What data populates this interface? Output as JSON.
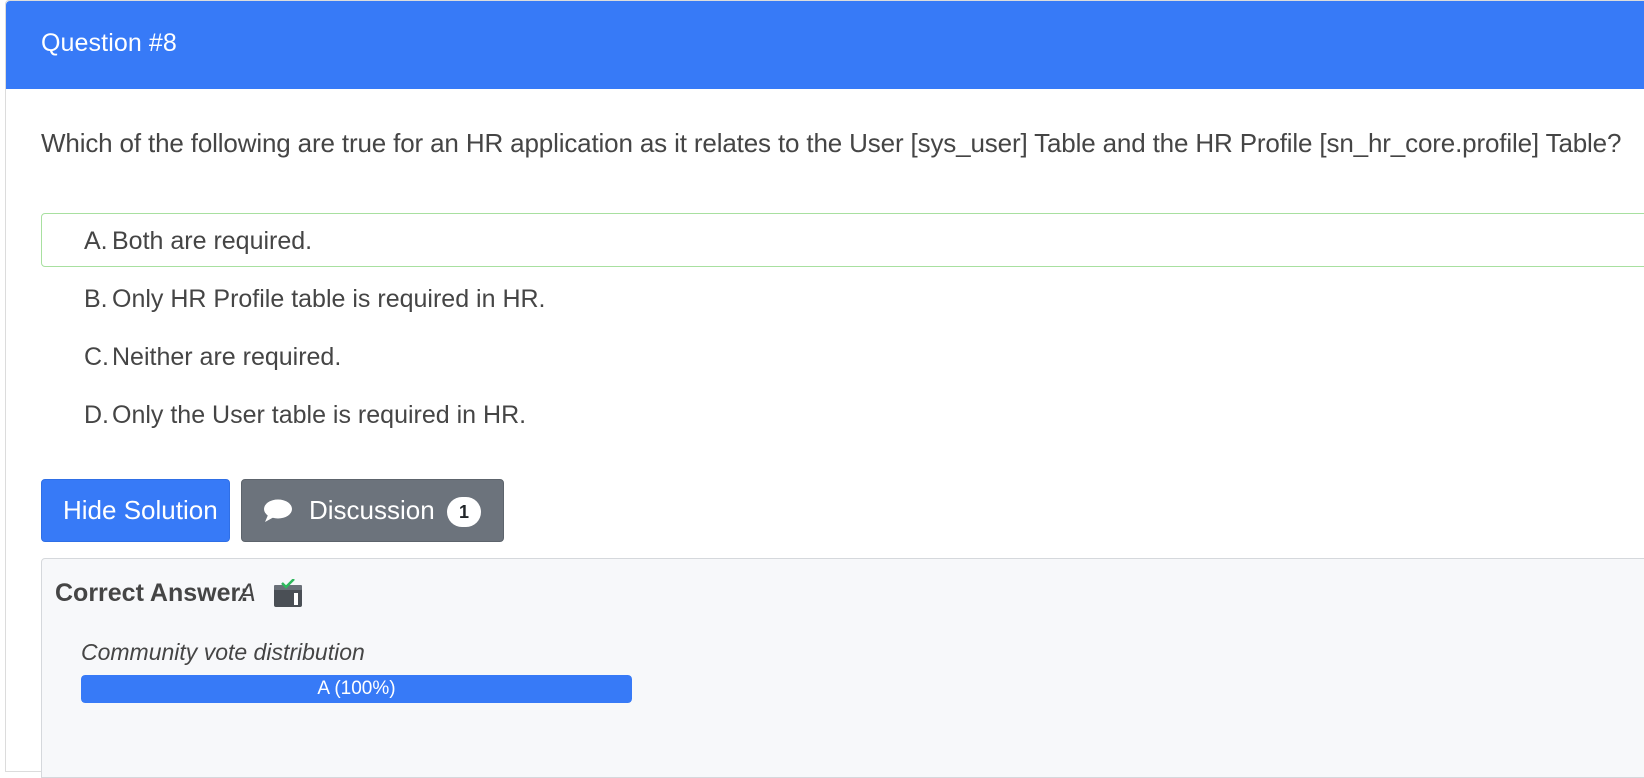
{
  "question": {
    "title": "Question #8",
    "text": "Which of the following are true for an HR application as it relates to the User [sys_user] Table and the HR Profile [sn_hr_core.profile] Table?",
    "choices": [
      {
        "letter": "A.",
        "text": "Both are required.",
        "correct": true
      },
      {
        "letter": "B.",
        "text": "Only HR Profile table is required in HR.",
        "correct": false
      },
      {
        "letter": "C.",
        "text": "Neither are required.",
        "correct": false
      },
      {
        "letter": "D.",
        "text": "Only the User table is required in HR.",
        "correct": false
      }
    ]
  },
  "actions": {
    "hide_solution_label": "Hide Solution",
    "discussion_label": "Discussion",
    "discussion_count": "1",
    "discussion_icon": "speech-bubble-icon"
  },
  "solution": {
    "correct_answer_label": "Correct Answer:",
    "correct_answer_value": "A",
    "reveal_icon": "reveal-solution-icon",
    "vote_title": "Community vote distribution",
    "votes": [
      {
        "label": "A (100%)",
        "fraction": 1.0
      }
    ]
  },
  "colors": {
    "primary": "#377af7",
    "secondary": "#6c737c",
    "correct_border": "#a8e0a0",
    "text": "#454545",
    "answer_bg": "#f7f8fa"
  }
}
